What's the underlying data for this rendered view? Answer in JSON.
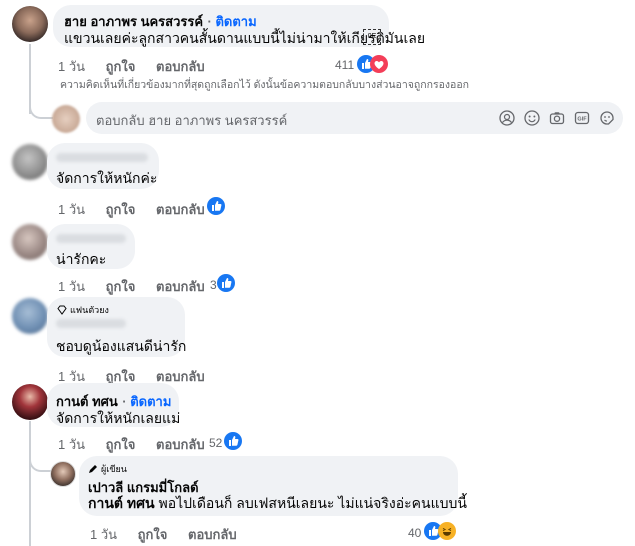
{
  "comments": [
    {
      "author": "ฮาย อาภาพร นครสวรรค์",
      "follow": "ติดตาม",
      "text": "แขวนเลยค่ะลูกสาวคนสั้นดานแบบนี้ไม่น่ามาให้เกียรติมันเลย",
      "time": "1 วัน",
      "like": "ถูกใจ",
      "reply": "ตอบกลับ",
      "reactions": "411"
    },
    {
      "text": "จัดการให้หนักค่ะ",
      "time": "1 วัน",
      "like": "ถูกใจ",
      "reply": "ตอบกลับ"
    },
    {
      "text": "น่ารักคะ",
      "time": "1 วัน",
      "like": "ถูกใจ",
      "reply": "ตอบกลับ",
      "reactions": "3"
    },
    {
      "badge": "แฟนตัวยง",
      "text": "ชอบดูน้องแสนดีน่ารัก",
      "time": "1 วัน",
      "like": "ถูกใจ",
      "reply": "ตอบกลับ"
    },
    {
      "author": "กานต์ ทศน",
      "follow": "ติดตาม",
      "text": "จัดการให้หนักเลยแม่",
      "time": "1 วัน",
      "like": "ถูกใจ",
      "reply": "ตอบกลับ",
      "reactions": "52"
    },
    {
      "badge": "ผู้เขียน",
      "author": "เปาวลี แกรมมี่โกลด์",
      "mention": "กานต์ ทศน",
      "text": "พอไปเดือนก็ ลบเฟสหนีเลยนะ ไม่แน่จริงอ่ะคนแบบนี้",
      "time": "1 วัน",
      "like": "ถูกใจ",
      "reply": "ตอบกลับ",
      "reactions": "40"
    }
  ],
  "notice": "ความคิดเห็นที่เกี่ยวข้องมากที่สุดถูกเลือกไว้ ดังนั้นข้อความตอบกลับบางส่วนอาจถูกกรองออก",
  "reply_box": {
    "placeholder": "ตอบกลับ ฮาย อาภาพร นครสวรรค์",
    "icons": [
      "avatar-sticker-icon",
      "emoji-icon",
      "camera-icon",
      "gif-icon",
      "sticker-icon"
    ]
  },
  "colors": {
    "link": "#0866ff",
    "bubble": "#f0f2f5",
    "like": "#1877f2",
    "love": "#f33e58"
  }
}
